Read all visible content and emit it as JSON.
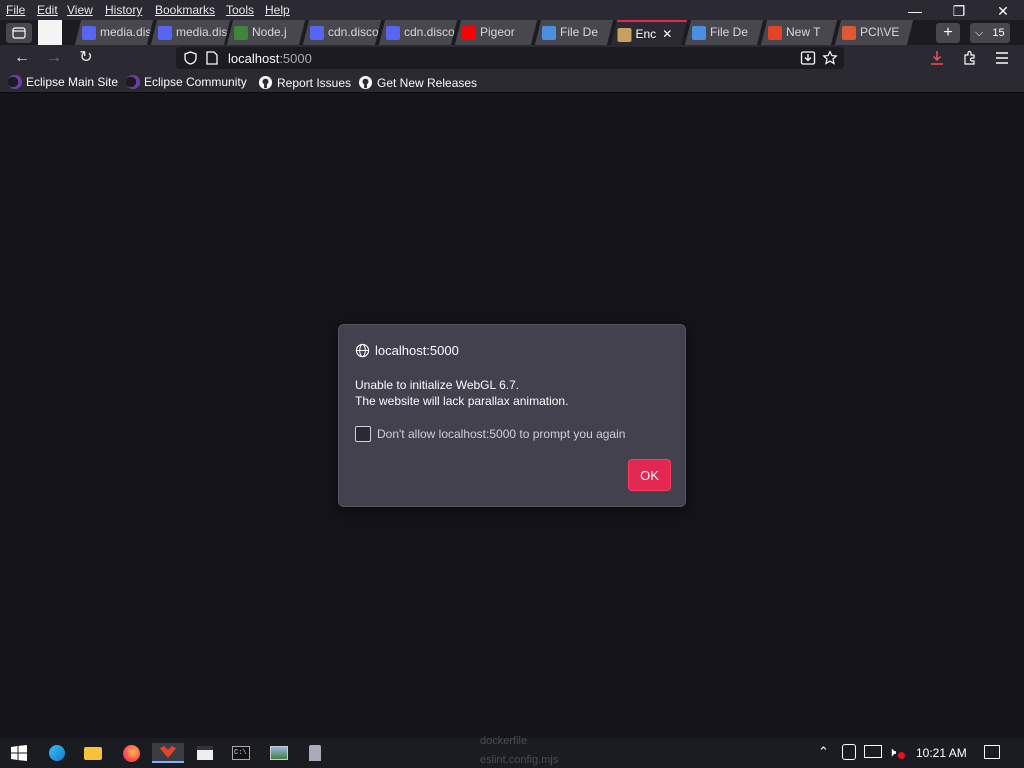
{
  "menubar": {
    "items": [
      "File",
      "Edit",
      "View",
      "History",
      "Bookmarks",
      "Tools",
      "Help"
    ]
  },
  "window_controls": {
    "minimize": "—",
    "restore": "❐",
    "close": "✕"
  },
  "tabs": [
    {
      "label": "media.disc",
      "icon": "discord-icon",
      "color": "#5865f2"
    },
    {
      "label": "media.disc",
      "icon": "discord-icon",
      "color": "#5865f2"
    },
    {
      "label": "Node.j",
      "icon": "nodejs-icon",
      "color": "#3c873a"
    },
    {
      "label": "cdn.discor",
      "icon": "discord-icon",
      "color": "#5865f2"
    },
    {
      "label": "cdn.discor",
      "icon": "discord-icon",
      "color": "#5865f2"
    },
    {
      "label": "Pigeor",
      "icon": "youtube-icon",
      "color": "#ff0000"
    },
    {
      "label": "File De",
      "icon": "cloud-icon",
      "color": "#4a90e2"
    },
    {
      "label": "Enc",
      "icon": "lock-icon",
      "color": "#c8a060",
      "active": true
    },
    {
      "label": "File De",
      "icon": "cloud-icon",
      "color": "#4a90e2"
    },
    {
      "label": "New T",
      "icon": "fox-icon",
      "color": "#e24329"
    },
    {
      "label": "PCI\\VE",
      "icon": "duckduckgo-icon",
      "color": "#de5833"
    }
  ],
  "tab_count": "15",
  "nav": {
    "url_host": "localhost",
    "url_port": ":5000"
  },
  "bookmarks": [
    {
      "label": "Eclipse Main Site",
      "icon": "eclipse-icon"
    },
    {
      "label": "Eclipse Community",
      "icon": "eclipse-icon"
    },
    {
      "label": "Report Issues",
      "icon": "github-icon"
    },
    {
      "label": "Get New Releases",
      "icon": "github-icon"
    }
  ],
  "dialog": {
    "host": "localhost:5000",
    "message_line1": "Unable to initialize WebGL 6.7.",
    "message_line2": "The website will lack parallax animation.",
    "checkbox_label": "Don't allow localhost:5000 to prompt you again",
    "ok_label": "OK"
  },
  "taskbar": {
    "clock": "10:21 AM",
    "ghost_text_1": "dockerfile",
    "ghost_text_2": "eslint.config.mjs"
  },
  "colors": {
    "accent": "#e22850",
    "toolbar": "#2b2a33",
    "content_bg": "#15141b",
    "dialog_bg": "#42414d"
  }
}
